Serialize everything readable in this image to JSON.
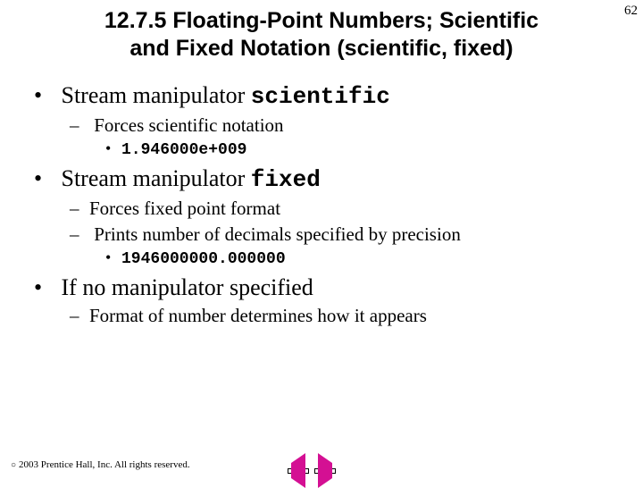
{
  "pageNumber": "62",
  "title_line1": "12.7.5 Floating-Point Numbers; Scientific",
  "title_line2": "and Fixed Notation (scientific, fixed)",
  "b1_pre": "Stream manipulator ",
  "b1_code": "scientific",
  "b1_s1": "Forces scientific notation",
  "b1_s1_ex": "1.946000e+009",
  "b2_pre": "Stream manipulator ",
  "b2_code": "fixed",
  "b2_s1": "Forces fixed point format",
  "b2_s2": "Prints number of decimals specified by precision",
  "b2_s2_ex": "1946000000.000000",
  "b3": "If no manipulator specified",
  "b3_s1": "Format of number determines how it appears",
  "copyright": "2003 Prentice Hall, Inc. All rights reserved."
}
